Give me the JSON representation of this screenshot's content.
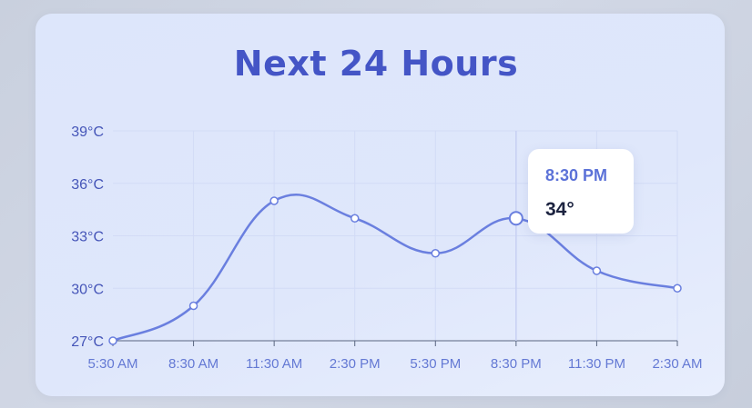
{
  "card": {
    "title": "Next 24 Hours"
  },
  "tooltip": {
    "time": "8:30 PM",
    "value": "34°"
  },
  "colors": {
    "line": "#6a7fdf",
    "title": "#4455c6",
    "point_fill": "#ffffff",
    "crosshair": "#c7d0f3",
    "grid": "#d2dbf6"
  },
  "chart_data": {
    "type": "line",
    "title": "Next 24 Hours",
    "categories": [
      "5:30 AM",
      "8:30 AM",
      "11:30 AM",
      "2:30 PM",
      "5:30 PM",
      "8:30 PM",
      "11:30 PM",
      "2:30 AM"
    ],
    "series": [
      {
        "values": [
          27,
          29,
          35,
          34,
          32,
          34,
          31,
          30
        ]
      }
    ],
    "ylim": [
      27,
      39
    ],
    "yticks": [
      27,
      30,
      33,
      36,
      39
    ],
    "ytick_labels": [
      "27°C",
      "30°C",
      "33°C",
      "36°C",
      "39°C"
    ],
    "grid": true,
    "highlighted_index": 5
  }
}
